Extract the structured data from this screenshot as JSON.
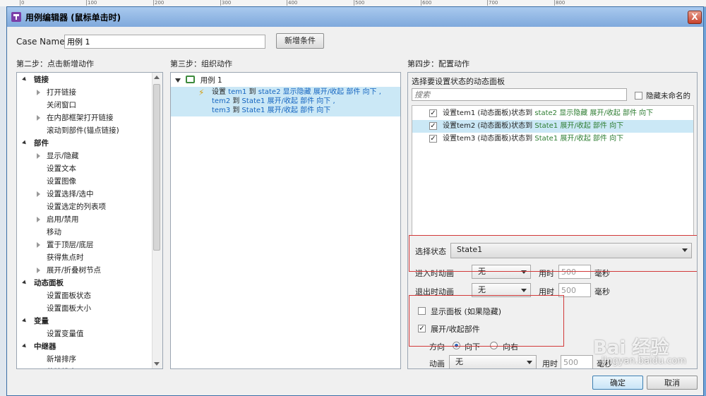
{
  "ruler": {
    "ticks": [
      "0",
      "100",
      "200",
      "300",
      "400",
      "500",
      "600",
      "700",
      "800"
    ]
  },
  "window": {
    "title": "用例编辑器 (鼠标单击时)",
    "close_label": "X"
  },
  "case": {
    "label": "Case Name",
    "value": "用例 1",
    "add_condition": "新增条件"
  },
  "step2": {
    "title": "第二步：点击新增动作",
    "groups": [
      {
        "label": "链接",
        "items": [
          "打开链接",
          "关闭窗口",
          "在内部框架打开链接",
          "滚动到部件(锚点链接)"
        ]
      },
      {
        "label": "部件",
        "items": [
          "显示/隐藏",
          "设置文本",
          "设置图像",
          "设置选择/选中",
          "设置选定的列表项",
          "启用/禁用",
          "移动",
          "置于顶层/底层",
          "获得焦点时",
          "展开/折叠树节点"
        ]
      },
      {
        "label": "动态面板",
        "items": [
          "设置面板状态",
          "设置面板大小"
        ]
      },
      {
        "label": "变量",
        "items": [
          "设置变量值"
        ]
      },
      {
        "label": "中继器",
        "items": [
          "新增排序",
          "移除排序"
        ]
      }
    ]
  },
  "step3": {
    "title": "第三步：组织动作",
    "case_label": "用例 1",
    "action_lines": [
      {
        "pre": "设置 ",
        "name": "tem1",
        "mid": " 到 ",
        "state": "state2",
        "post": " 显示隐藏 展开/收起 部件 向下 ,"
      },
      {
        "pre": "",
        "name": "tem2",
        "mid": " 到 ",
        "state": "State1",
        "post": " 展开/收起 部件 向下 ,"
      },
      {
        "pre": "",
        "name": "tem3",
        "mid": " 到 ",
        "state": "State1",
        "post": " 展开/收起 部件 向下"
      }
    ]
  },
  "step4": {
    "title": "第四步：配置动作",
    "subtitle": "选择要设置状态的动态面板",
    "search_placeholder": "搜索",
    "hide_unnamed": "隐藏未命名的",
    "panels": [
      {
        "prefix": "设置tem1 (动态面板)状态到 ",
        "state": "state2",
        "suffix": " 显示隐藏 展开/收起 部件 向下",
        "checked": true,
        "selected": false
      },
      {
        "prefix": "设置tem2 (动态面板)状态到 ",
        "state": "State1",
        "suffix": " 展开/收起 部件 向下",
        "checked": true,
        "selected": true
      },
      {
        "prefix": "设置tem3 (动态面板)状态到 ",
        "state": "State1",
        "suffix": " 展开/收起 部件 向下",
        "checked": true,
        "selected": false
      }
    ],
    "select_state_label": "选择状态",
    "select_state_value": "State1",
    "enter_anim_label": "进入时动画",
    "enter_anim_value": "无",
    "exit_anim_label": "退出时动画",
    "exit_anim_value": "无",
    "time_label": "用时",
    "time_value": "500",
    "ms_label": "毫秒",
    "show_panel_label": "显示面板 (如果隐藏)",
    "expand_label": "展开/收起部件",
    "direction_label": "方向",
    "dir_down": "向下",
    "dir_right": "向右",
    "anim_label": "动画",
    "anim_value": "无"
  },
  "footer": {
    "ok": "确定",
    "cancel": "取消"
  },
  "watermark": {
    "text": "Bai 经验",
    "url": "jingyan.baidu.com"
  }
}
